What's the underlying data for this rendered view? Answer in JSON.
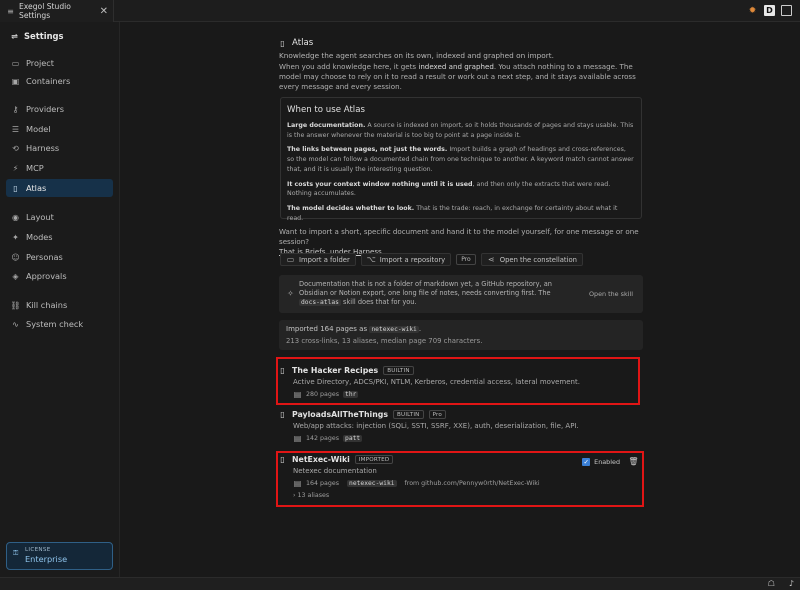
{
  "window": {
    "tab_title": "Exegol Studio Settings",
    "tab_close": "✕"
  },
  "sidebar": {
    "title": "Settings",
    "items": [
      {
        "label": "Project",
        "icon": "folder-icon"
      },
      {
        "label": "Containers",
        "icon": "container-icon"
      },
      {
        "label": "Providers",
        "icon": "key-icon"
      },
      {
        "label": "Model",
        "icon": "sliders-icon"
      },
      {
        "label": "Harness",
        "icon": "harness-icon"
      },
      {
        "label": "MCP",
        "icon": "plug-icon"
      },
      {
        "label": "Atlas",
        "icon": "book-icon",
        "active": true
      },
      {
        "label": "Layout",
        "icon": "eye-icon"
      },
      {
        "label": "Modes",
        "icon": "sparkle-icon"
      },
      {
        "label": "Personas",
        "icon": "person-icon"
      },
      {
        "label": "Approvals",
        "icon": "shield-icon"
      },
      {
        "label": "Kill chains",
        "icon": "chain-icon"
      },
      {
        "label": "System check",
        "icon": "activity-icon"
      }
    ],
    "license": {
      "label": "LICENSE",
      "value": "Enterprise"
    }
  },
  "atlas": {
    "title": "Atlas",
    "subtitle": "Knowledge the agent searches on its own, indexed and graphed on import.",
    "desc_pre": "When you add knowledge here, it gets ",
    "desc_bold": "indexed and graphed",
    "desc_post": ". You attach nothing to a message. The model may choose to rely on it to read a result or work out a next step, and it stays available across every message and every session.",
    "when": {
      "title": "When to use Atlas",
      "points": [
        {
          "bold": "Large documentation.",
          "text": " A source is indexed on import, so it holds thousands of pages and stays usable. This is the answer whenever the material is too big to point at a page inside it."
        },
        {
          "bold": "The links between pages, not just the words.",
          "text": " Import builds a graph of headings and cross-references, so the model can follow a documented chain from one technique to another. A keyword match cannot answer that, and it is usually the interesting question."
        },
        {
          "bold": "It costs your context window nothing until it is used",
          "text": ", and then only the extracts that were read. Nothing accumulates."
        },
        {
          "bold": "The model decides whether to look.",
          "text": " That is the trade: reach, in exchange for certainty about what it read."
        }
      ]
    },
    "want_text": "Want to import a short, specific document and hand it to the model yourself, for one message or one session?",
    "want_link": "That is Briefs, under Harness.",
    "buttons": {
      "import_folder": "Import a folder",
      "import_repo": "Import a repository",
      "pro": "Pro",
      "constellation": "Open the constellation"
    },
    "notice": {
      "text_pre": "Documentation that is not a folder of markdown yet, a GitHub repository, an Obsidian or Notion export, one long file of notes, needs converting first. The ",
      "code": "docs-atlas",
      "text_post": " skill does that for you.",
      "open": "Open the skill"
    },
    "imported": {
      "pre": "Imported ",
      "count": "164",
      "mid": " pages as ",
      "code": "netexec-wiki",
      "post": ".",
      "line2": "213 cross-links, 13 aliases, median page 709 characters."
    },
    "entries": [
      {
        "name": "The Hacker Recipes",
        "badge": "BUILTIN",
        "desc": "Active Directory, ADCS/PKI, NTLM, Kerberos, credential access, lateral movement.",
        "pages": "280 pages",
        "code": "thr"
      },
      {
        "name": "PayloadsAllTheThings",
        "badge": "BUILTIN",
        "badge2": "Pro",
        "desc": "Web/app attacks: injection (SQLi, SSTI, SSRF, XXE), auth, deserialization, file, API.",
        "pages": "142 pages",
        "code": "patt"
      },
      {
        "name": "NetExec-Wiki",
        "badge": "IMPORTED",
        "desc": "Netexec documentation",
        "pages": "164 pages",
        "code": "netexec-wiki",
        "source": "from github.com/Pennyw0rth/NetExec-Wiki",
        "aliases": "› 13 aliases",
        "enabled": "Enabled"
      }
    ]
  }
}
